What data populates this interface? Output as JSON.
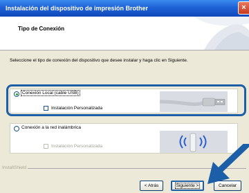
{
  "window": {
    "title": "Instalación del dispositivo de impresión Brother",
    "close_glyph": "×"
  },
  "header": {
    "title": "Tipo de Conexión"
  },
  "instruction": "Seleccione el tipo de conexión del dispositivo que desee instalar y haga clic en Siguiente.",
  "options": {
    "local": {
      "label": "Conexión Local (cable USB)",
      "selected": true,
      "icon": "usb-cable-icon"
    },
    "local_custom": {
      "label": "Instalación Personalizada",
      "checked": false
    },
    "wireless": {
      "label": "Conexión a la red inalámbrica",
      "selected": false,
      "icon": "wireless-icon"
    },
    "wireless_custom": {
      "label": "Instalación Personalizada",
      "checked": false,
      "disabled": true
    }
  },
  "footer": {
    "brand": "InstallShield"
  },
  "buttons": {
    "back": "< Atrás",
    "next": "Siguiente >",
    "cancel": "Cancelar"
  },
  "colors": {
    "titlebar": "#1f62d6",
    "highlight": "#1c5ea8",
    "dialog_bg": "#ece9d8"
  }
}
